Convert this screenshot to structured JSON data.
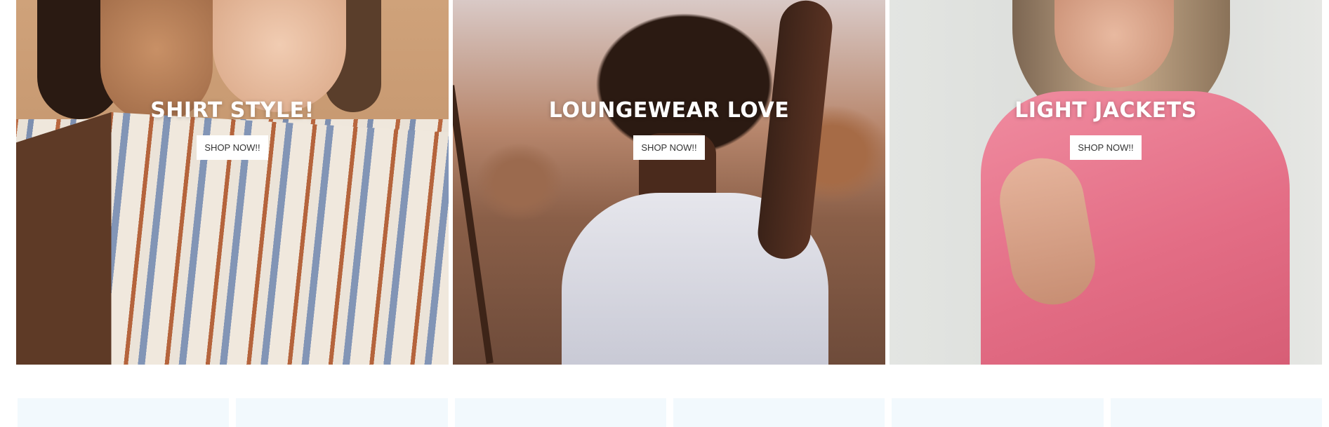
{
  "banners": [
    {
      "title": "SHIRT STYLE!",
      "button_label": "SHOP NOW!!"
    },
    {
      "title": "LOUNGEWEAR LOVE",
      "button_label": "SHOP NOW!!"
    },
    {
      "title": "LIGHT JACKETS",
      "button_label": "SHOP NOW!!"
    }
  ],
  "colors": {
    "page_background": "#ffffff",
    "banner_title": "#ffffff",
    "button_background": "#ffffff",
    "button_text": "#333333",
    "tile_background": "#f2f9fd"
  },
  "tiles_count": 6
}
